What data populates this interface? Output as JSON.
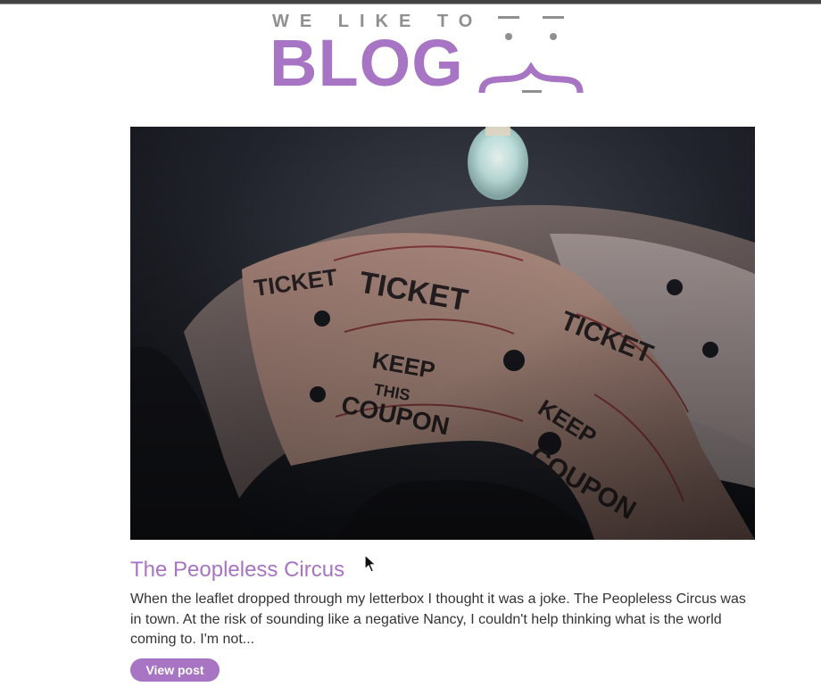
{
  "logo": {
    "tagline": "WE LIKE TO",
    "word": "BLOG"
  },
  "post": {
    "image_icon": "movie-tickets-photo",
    "title": "The Peopleless Circus",
    "excerpt": "When the leaflet dropped through my letterbox I thought it was a joke. The Peopleless Circus was in town. At the risk of sounding like a negative Nancy, I couldn't help thinking what is the world coming to. I'm not...",
    "button_label": "View post"
  },
  "colors": {
    "accent": "#a874c4",
    "tagline": "#8f8f8f",
    "text": "#333333",
    "background": "#ffffff"
  }
}
